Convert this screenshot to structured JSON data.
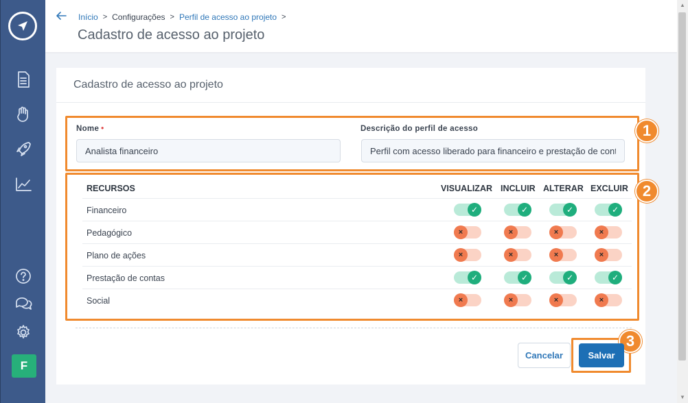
{
  "header": {
    "breadcrumb": [
      {
        "label": "Início",
        "link": true
      },
      {
        "label": "Configurações",
        "link": false
      },
      {
        "label": "Perfil de acesso ao projeto",
        "link": true
      }
    ],
    "title": "Cadastro de acesso ao projeto"
  },
  "sidebar": {
    "avatar_initial": "F",
    "icons": [
      "document-icon",
      "hand-heart-icon",
      "rocket-icon",
      "chart-trend-icon",
      "help-icon",
      "chat-icon",
      "gear-icon"
    ]
  },
  "card": {
    "title": "Cadastro de acesso ao projeto"
  },
  "form": {
    "name_label": "Nome",
    "name_required_mark": "•",
    "name_value": "Analista financeiro",
    "description_label": "Descrição do perfil de acesso",
    "description_value": "Perfil com acesso liberado para financeiro e prestação de contas"
  },
  "permissions": {
    "columns": {
      "resource": "RECURSOS",
      "view": "VISUALIZAR",
      "include": "INCLUIR",
      "edit": "ALTERAR",
      "delete": "EXCLUIR"
    },
    "rows": [
      {
        "name": "Financeiro",
        "view": true,
        "include": true,
        "edit": true,
        "delete": true
      },
      {
        "name": "Pedagógico",
        "view": false,
        "include": false,
        "edit": false,
        "delete": false
      },
      {
        "name": "Plano de ações",
        "view": false,
        "include": false,
        "edit": false,
        "delete": false
      },
      {
        "name": "Prestação de contas",
        "view": true,
        "include": true,
        "edit": true,
        "delete": true
      },
      {
        "name": "Social",
        "view": false,
        "include": false,
        "edit": false,
        "delete": false
      }
    ]
  },
  "annotations": [
    "1",
    "2",
    "3"
  ],
  "actions": {
    "cancel_label": "Cancelar",
    "save_label": "Salvar"
  },
  "colors": {
    "sidebar": "#3d5a8a",
    "accent": "#1d6fb5",
    "annotation": "#f08a2e",
    "toggle_on": "#1fae7d",
    "toggle_off": "#f07a4f"
  }
}
